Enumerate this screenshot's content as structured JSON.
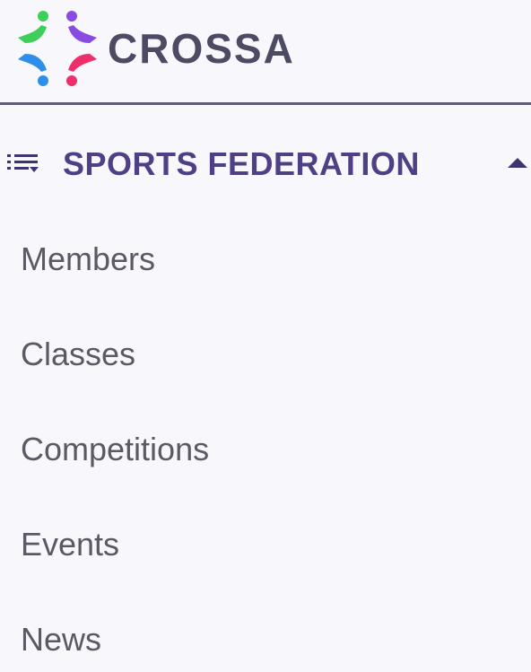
{
  "brand": {
    "name": "CROSSA",
    "logo_icon": "four-figures-logo-icon",
    "logo_colors": [
      "#3ecf5a",
      "#8a4be0",
      "#2f8fe8",
      "#ee2f6a"
    ]
  },
  "nav": {
    "section": {
      "title": "SPORTS FEDERATION",
      "icon": "list-icon",
      "toggle_icon": "caret-up-icon",
      "expanded": true
    },
    "items": [
      {
        "label": "Members"
      },
      {
        "label": "Classes"
      },
      {
        "label": "Competitions"
      },
      {
        "label": "Events"
      },
      {
        "label": "News"
      }
    ]
  },
  "colors": {
    "background": "#f7f7fc",
    "section_title": "#4f3f85",
    "menu_text": "#5a5964",
    "brand_text": "#4d4a63",
    "divider": "#5e5a78"
  }
}
